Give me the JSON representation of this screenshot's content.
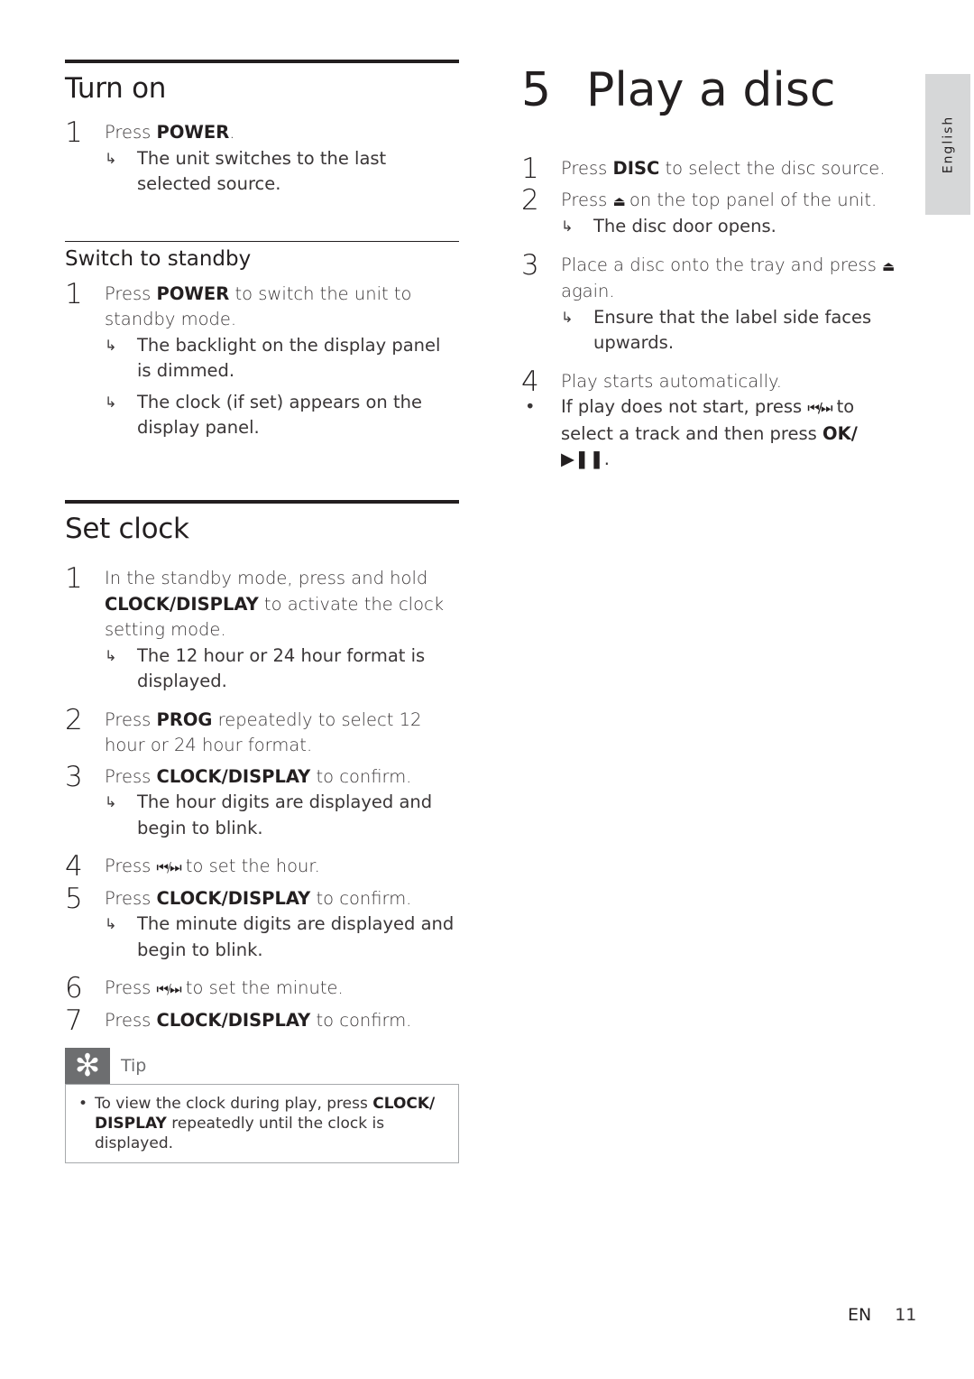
{
  "turn_on": {
    "title": "Turn on",
    "steps": [
      {
        "num": "1",
        "pre": "Press ",
        "key": "POWER",
        "post": ".",
        "result": "The unit switches to the last selected source."
      }
    ]
  },
  "standby": {
    "title": "Switch to standby",
    "step_num": "1",
    "pre": "Press ",
    "key": "POWER",
    "post": " to switch the unit to standby mode.",
    "results": [
      "The backlight on the display panel is dimmed.",
      "The clock (if set) appears on the display panel."
    ]
  },
  "set_clock": {
    "title": "Set clock",
    "steps": [
      {
        "num": "1",
        "pre": "In the standby mode, press and hold ",
        "key": "CLOCK/DISPLAY",
        "post": " to activate the clock setting mode.",
        "result": "The 12 hour or 24 hour format is displayed."
      },
      {
        "num": "2",
        "pre": "Press ",
        "key": "PROG",
        "post": " repeatedly to select 12 hour or 24 hour format.",
        "result": ""
      },
      {
        "num": "3",
        "pre": "Press ",
        "key": "CLOCK/DISPLAY",
        "post": " to confirm.",
        "result": "The hour digits are displayed and begin to blink."
      },
      {
        "num": "4",
        "pre": "Press ",
        "key": "⏮/⏭",
        "post": " to set the hour.",
        "result": ""
      },
      {
        "num": "5",
        "pre": "Press ",
        "key": "CLOCK/DISPLAY",
        "post": " to confirm.",
        "result": "The minute digits are displayed and begin to blink."
      },
      {
        "num": "6",
        "pre": "Press ",
        "key": "⏮/⏭",
        "post": " to set the minute.",
        "result": ""
      },
      {
        "num": "7",
        "pre": "Press ",
        "key": "CLOCK/DISPLAY",
        "post": " to confirm.",
        "result": ""
      }
    ],
    "tip": {
      "label": "Tip",
      "icon": "asterisk-icon",
      "pre": "To view the clock during play, press ",
      "key": "CLOCK/ DISPLAY",
      "post": " repeatedly until the clock is displayed."
    }
  },
  "play_disc": {
    "chapter_num": "5",
    "title": "Play a disc",
    "steps": [
      {
        "num": "1",
        "pre": "Press ",
        "key": "DISC",
        "post": " to select the disc source.",
        "result": ""
      },
      {
        "num": "2",
        "pre": "Press ",
        "key": "⏏",
        "post": " on the top panel of the unit.",
        "result": "The disc door opens."
      },
      {
        "num": "3",
        "pre": "Place a disc onto the tray and press ",
        "key": "⏏",
        "post": " again.",
        "result": "Ensure that the label side faces upwards."
      },
      {
        "num": "4",
        "pre": "Play starts automatically.",
        "key": "",
        "post": "",
        "result": ""
      }
    ],
    "bullet": {
      "pre": "If play does not start, press ",
      "key1": "⏮/⏭",
      "mid": " to select a track and then press ",
      "key2": "OK/▶❚❚",
      "post": "."
    }
  },
  "side_tab": {
    "label": "English"
  },
  "footer": {
    "lang": "EN",
    "page": "11"
  },
  "result_arrow": "↳"
}
